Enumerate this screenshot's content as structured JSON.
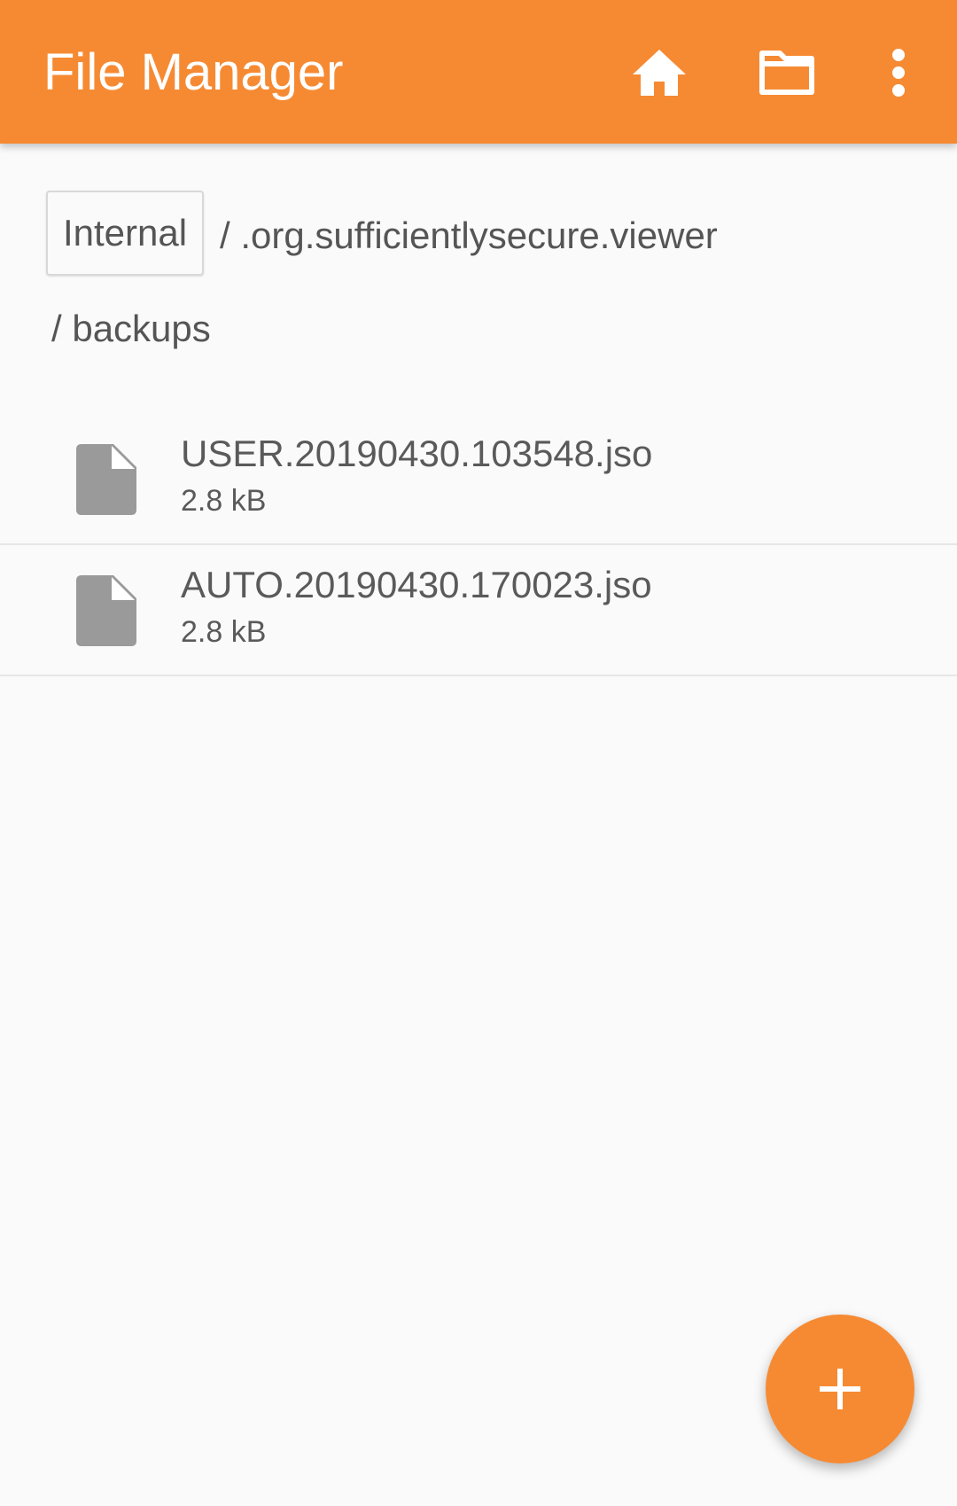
{
  "appbar": {
    "title": "File Manager",
    "background": "#f68a33",
    "actions": [
      {
        "name": "home",
        "icon": "home-icon"
      },
      {
        "name": "folder",
        "icon": "folder-icon"
      },
      {
        "name": "more",
        "icon": "more-vert-icon"
      }
    ]
  },
  "breadcrumb": {
    "root": "Internal",
    "segments": [
      "/ .org.sufficientlysecure.viewer",
      "/ backups"
    ]
  },
  "files": [
    {
      "name": "USER.20190430.103548.jso",
      "size": "2.8 kB",
      "icon": "file-icon"
    },
    {
      "name": "AUTO.20190430.170023.jso",
      "size": "2.8 kB",
      "icon": "file-icon"
    }
  ],
  "fab": {
    "icon": "plus-icon",
    "color": "#f68a33"
  }
}
